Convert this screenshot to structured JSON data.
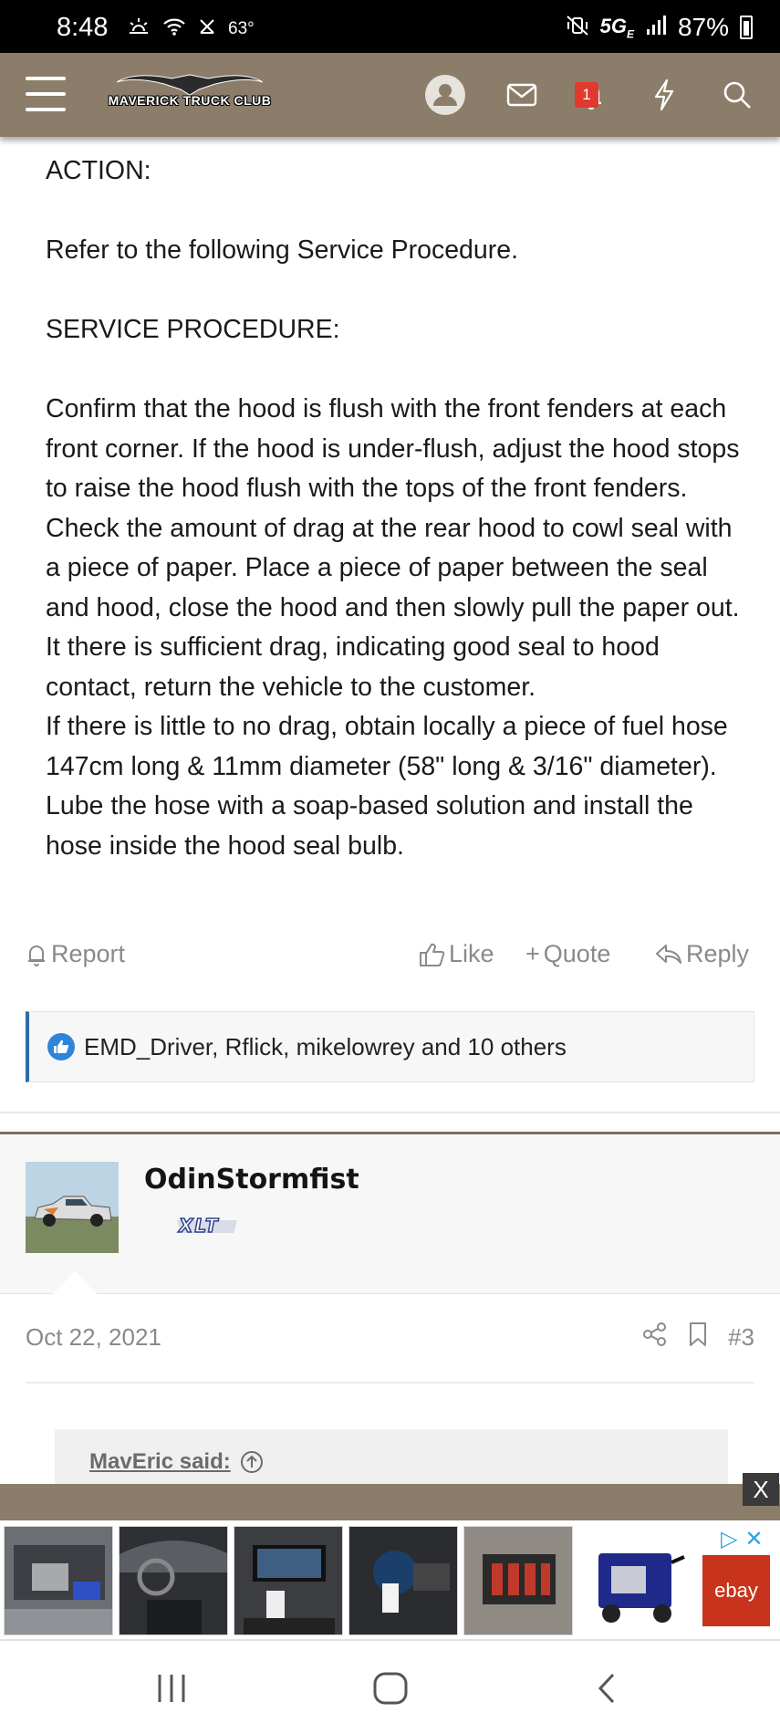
{
  "status_bar": {
    "time": "8:48",
    "temperature": "63°",
    "network": "5G",
    "network_sub": "E",
    "battery": "87%"
  },
  "header": {
    "site_name": "MAVERICK TRUCK CLUB",
    "alert_count": "1",
    "icons": [
      "menu-icon",
      "avatar-icon",
      "mail-icon",
      "bell-icon",
      "lightning-icon",
      "search-icon"
    ],
    "bar_color": "#8b7d6a"
  },
  "post": {
    "action_heading": "ACTION:",
    "refer_line": "Refer to the following Service Procedure.",
    "procedure_heading": "SERVICE PROCEDURE:",
    "paragraph_1": "Confirm that the hood is flush with the front fenders at each front corner. If the hood is under-flush, adjust the hood stops to raise the hood flush with the tops of the front fenders. Check the amount of drag at the rear hood to cowl seal with a piece of paper. Place a piece of paper between the seal and hood, close the hood and then slowly pull the paper out. It there is sufficient drag, indicating good seal to hood contact, return the vehicle to the customer.",
    "paragraph_2": "If there is little to no drag, obtain locally a piece of fuel hose 147cm long & 11mm diameter (58\" long & 3/16\" diameter). Lube the hose with a soap-based solution and install the hose inside the hood seal bulb."
  },
  "actions": {
    "report": "Report",
    "like": "Like",
    "quote": "Quote",
    "reply": "Reply"
  },
  "reactions": {
    "text": "EMD_Driver, Rflick, mikelowrey and 10 others",
    "accent_color": "#2f6aa8"
  },
  "next_post": {
    "username": "OdinStormfist",
    "rank": "XLT",
    "date": "Oct 22, 2021",
    "post_number": "#3",
    "quote_author": "MavEric said:"
  },
  "ad": {
    "close_label": "X",
    "brand": "ebay",
    "brand_color": "#c7331b"
  }
}
